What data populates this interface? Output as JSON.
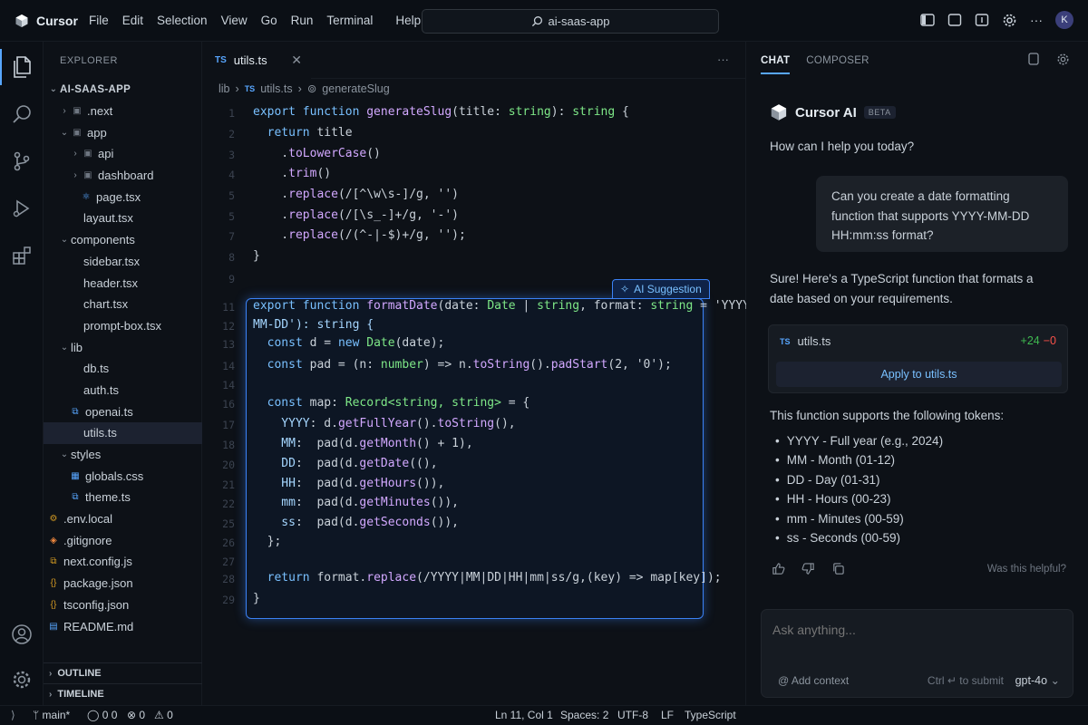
{
  "app": {
    "name": "Cursor"
  },
  "menu": [
    "File",
    "Edit",
    "Selection",
    "View",
    "Go",
    "Run",
    "Terminal",
    "Help"
  ],
  "command_search": {
    "label": "ai-saas-app"
  },
  "user": {
    "avatar_initial": "K"
  },
  "explorer": {
    "title": "EXPLORER",
    "root": "AI-SAAS-APP",
    "tree": [
      {
        "label": ".next",
        "icon": "folder-icon",
        "indent": 1,
        "kind": "folder-closed"
      },
      {
        "label": "app",
        "icon": "folder-icon",
        "indent": 1,
        "kind": "folder-open"
      },
      {
        "label": "api",
        "icon": "folder-icon",
        "indent": 2,
        "kind": "folder-closed"
      },
      {
        "label": "dashboard",
        "icon": "folder-icon",
        "indent": 2,
        "kind": "folder-closed"
      },
      {
        "label": "page.tsx",
        "icon": "react-icon",
        "indent": 3,
        "kind": "file"
      },
      {
        "label": "layaut.tsx",
        "icon": "",
        "indent": 3,
        "kind": "file"
      },
      {
        "label": "components",
        "icon": "",
        "indent": 1,
        "kind": "folder-open"
      },
      {
        "label": "sidebar.tsx",
        "icon": "",
        "indent": 3,
        "kind": "file"
      },
      {
        "label": "header.tsx",
        "icon": "",
        "indent": 3,
        "kind": "file"
      },
      {
        "label": "chart.tsx",
        "icon": "",
        "indent": 3,
        "kind": "file"
      },
      {
        "label": "prompt-box.tsx",
        "icon": "",
        "indent": 3,
        "kind": "file"
      },
      {
        "label": "lib",
        "icon": "",
        "indent": 1,
        "kind": "folder-open"
      },
      {
        "label": "db.ts",
        "icon": "",
        "indent": 3,
        "kind": "file"
      },
      {
        "label": "auth.ts",
        "icon": "",
        "indent": 3,
        "kind": "file"
      },
      {
        "label": "openai.ts",
        "icon": "ts-file-icon",
        "indent": 2,
        "kind": "file"
      },
      {
        "label": "utils.ts",
        "icon": "",
        "indent": 3,
        "kind": "file",
        "selected": true
      },
      {
        "label": "styles",
        "icon": "",
        "indent": 1,
        "kind": "folder-open"
      },
      {
        "label": "globals.css",
        "icon": "css-icon",
        "indent": 2,
        "kind": "file"
      },
      {
        "label": "theme.ts",
        "icon": "ts-file-icon",
        "indent": 2,
        "kind": "file"
      },
      {
        "label": ".env.local",
        "icon": "settings-file-icon",
        "indent": 0,
        "kind": "file"
      },
      {
        "label": ".gitignore",
        "icon": "git-icon",
        "indent": 0,
        "kind": "file"
      },
      {
        "label": "next.config.js",
        "icon": "js-icon",
        "indent": 0,
        "kind": "file"
      },
      {
        "label": "package.json",
        "icon": "json-icon",
        "indent": 0,
        "kind": "file"
      },
      {
        "label": "tsconfig.json",
        "icon": "json-icon",
        "indent": 0,
        "kind": "file"
      },
      {
        "label": "README.md",
        "icon": "markdown-icon",
        "indent": 0,
        "kind": "file"
      }
    ],
    "outline": "OUTLINE",
    "timeline": "TIMELINE"
  },
  "editor": {
    "tab": {
      "lang": "TS",
      "name": "utils.ts"
    },
    "breadcrumbs": {
      "folder": "lib",
      "lang": "TS",
      "file": "utils.ts",
      "symbol": "generateSlug"
    },
    "suggestion_label": "AI Suggestion",
    "lines": [
      {
        "n": "1",
        "t": [
          [
            "kw",
            "export function "
          ],
          [
            "fn",
            "generateSlug"
          ],
          [
            "",
            "(title: "
          ],
          [
            "ty",
            "string"
          ],
          [
            "",
            "): "
          ],
          [
            "ty",
            "string"
          ],
          [
            "",
            " {"
          ]
        ]
      },
      {
        "n": "2",
        "t": [
          [
            "",
            "  "
          ],
          [
            "kw",
            "return"
          ],
          [
            "",
            " title"
          ]
        ]
      },
      {
        "n": "3",
        "t": [
          [
            "",
            "    ."
          ],
          [
            "fn",
            "toLowerCase"
          ],
          [
            "",
            "()"
          ]
        ]
      },
      {
        "n": "4",
        "t": [
          [
            "",
            "    ."
          ],
          [
            "fn",
            "trim"
          ],
          [
            "",
            "()"
          ]
        ]
      },
      {
        "n": "5",
        "t": [
          [
            "",
            "    ."
          ],
          [
            "fn",
            "replace"
          ],
          [
            "",
            "(/[^\\w\\s-]/g, '')"
          ]
        ]
      },
      {
        "n": "5",
        "t": [
          [
            "",
            "    ."
          ],
          [
            "fn",
            "replace"
          ],
          [
            "",
            "(/[\\s_-]+/g, '-')"
          ]
        ]
      },
      {
        "n": "7",
        "t": [
          [
            "",
            "    ."
          ],
          [
            "fn",
            "replace"
          ],
          [
            "",
            "(/(^-|-$)+/g, '');"
          ]
        ]
      },
      {
        "n": "8",
        "t": [
          [
            "",
            "}"
          ]
        ]
      },
      {
        "n": "9",
        "t": []
      },
      {
        "n": "11",
        "t": [
          [
            "kw",
            "export function "
          ],
          [
            "fn",
            "formatDate"
          ],
          [
            "",
            "(date: "
          ],
          [
            "ty",
            "Date"
          ],
          [
            "",
            " | "
          ],
          [
            "ty",
            "string"
          ],
          [
            "",
            ", format: "
          ],
          [
            "ty",
            "string"
          ],
          [
            "",
            " = 'YYYY-"
          ]
        ]
      },
      {
        "n": "12",
        "t": [
          [
            "st",
            "MM-DD'): string {"
          ]
        ]
      },
      {
        "n": "13",
        "t": [
          [
            "",
            "  "
          ],
          [
            "kw",
            "const"
          ],
          [
            "",
            " d = "
          ],
          [
            "kw",
            "new"
          ],
          [
            "",
            " "
          ],
          [
            "ty",
            "Date"
          ],
          [
            "",
            "(date);"
          ]
        ]
      },
      {
        "n": "14",
        "t": [
          [
            "",
            "  "
          ],
          [
            "kw",
            "const"
          ],
          [
            "",
            " pad = (n: "
          ],
          [
            "ty",
            "number"
          ],
          [
            "",
            ") => n."
          ],
          [
            "fn",
            "toString"
          ],
          [
            "",
            "()."
          ],
          [
            "fn",
            "padStart"
          ],
          [
            "",
            "(2, '0');"
          ]
        ]
      },
      {
        "n": "14",
        "t": []
      },
      {
        "n": "16",
        "t": [
          [
            "",
            "  "
          ],
          [
            "kw",
            "const"
          ],
          [
            "",
            " map: "
          ],
          [
            "ty",
            "Record<string, string>"
          ],
          [
            "",
            " = {"
          ]
        ]
      },
      {
        "n": "17",
        "t": [
          [
            "st",
            "    YYYY"
          ],
          [
            "",
            ": d."
          ],
          [
            "fn",
            "getFullYear"
          ],
          [
            "",
            "()."
          ],
          [
            "fn",
            "toString"
          ],
          [
            "",
            "(),"
          ]
        ]
      },
      {
        "n": "18",
        "t": [
          [
            "st",
            "    MM"
          ],
          [
            "",
            ":  pad(d."
          ],
          [
            "fn",
            "getMonth"
          ],
          [
            "",
            "() + 1),"
          ]
        ]
      },
      {
        "n": "20",
        "t": [
          [
            "st",
            "    DD"
          ],
          [
            "",
            ":  pad(d."
          ],
          [
            "fn",
            "getDate"
          ],
          [
            "",
            "((),"
          ]
        ]
      },
      {
        "n": "21",
        "t": [
          [
            "st",
            "    HH"
          ],
          [
            "",
            ":  pad(d."
          ],
          [
            "fn",
            "getHours"
          ],
          [
            "",
            "()),"
          ]
        ]
      },
      {
        "n": "22",
        "t": [
          [
            "st",
            "    mm"
          ],
          [
            "",
            ":  pad(d."
          ],
          [
            "fn",
            "getMinutes"
          ],
          [
            "",
            "()),"
          ]
        ]
      },
      {
        "n": "25",
        "t": [
          [
            "st",
            "    ss"
          ],
          [
            "",
            ":  pad(d."
          ],
          [
            "fn",
            "getSeconds"
          ],
          [
            "",
            "()),"
          ]
        ]
      },
      {
        "n": "26",
        "t": [
          [
            "",
            "  };"
          ]
        ]
      },
      {
        "n": "27",
        "t": []
      },
      {
        "n": "28",
        "t": [
          [
            "",
            "  "
          ],
          [
            "kw",
            "return"
          ],
          [
            "",
            " format."
          ],
          [
            "fn",
            "replace"
          ],
          [
            "",
            "(/YYYY|MM|DD|HH|mm|ss/g,(key) => map[key]);"
          ]
        ]
      },
      {
        "n": "29",
        "t": [
          [
            "",
            "}"
          ]
        ]
      }
    ]
  },
  "chat": {
    "tabs": [
      "CHAT",
      "COMPOSER"
    ],
    "assistant_name": "Cursor AI",
    "badge": "BETA",
    "greeting": "How can I help you today?",
    "user_message": "Can you create a date formatting function that supports YYYY-MM-DD HH:mm:ss format?",
    "reply": "Sure! Here's a TypeScript function that formats a date based on your requirements.",
    "file_card": {
      "lang": "TS",
      "name": "utils.ts",
      "added": "+24",
      "removed": "−0",
      "apply_label": "Apply to utils.ts"
    },
    "support_text": "This function supports the following tokens:",
    "tokens": [
      "YYYY - Full year (e.g., 2024)",
      "MM - Month (01-12)",
      "DD - Day (01-31)",
      "HH - Hours (00-23)",
      "mm - Minutes (00-59)",
      "ss - Seconds (00-59)"
    ],
    "helpful": "Was this helpful?",
    "input_placeholder": "Ask anything...",
    "add_context": "@ Add context",
    "submit_hint": "Ctrl ↵ to submit",
    "model": "gpt-4o"
  },
  "status": {
    "branch": "main*",
    "sync": "0 0",
    "errors": "0",
    "warnings": "0",
    "position": "Ln 11, Col 1",
    "spaces": "Spaces: 2",
    "encoding": "UTF-8",
    "eol": "LF",
    "language": "TypeScript"
  },
  "colors": {
    "accent": "#3b82f6",
    "added": "#3fb950",
    "removed": "#f85149"
  }
}
